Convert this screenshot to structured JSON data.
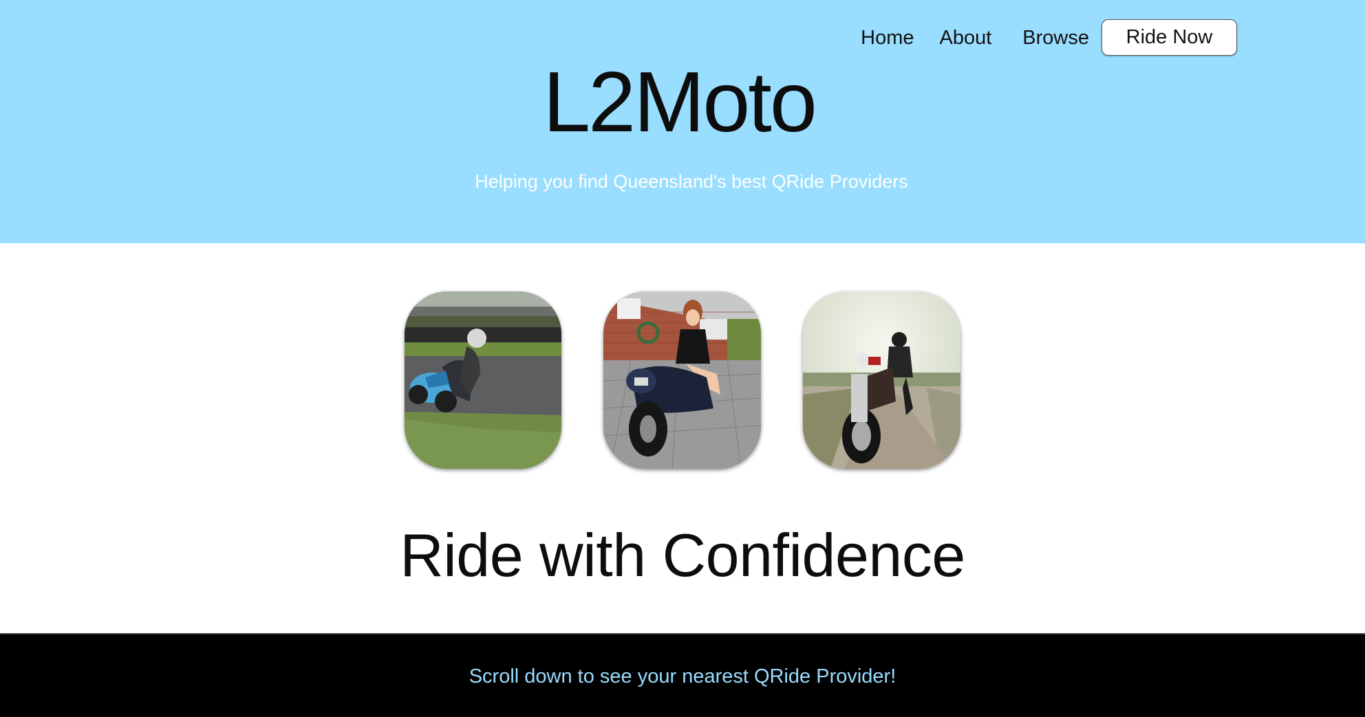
{
  "nav": {
    "home": "Home",
    "about": "About",
    "browse": "Browse",
    "ride_now": "Ride Now"
  },
  "hero": {
    "title": "L2Moto",
    "tagline": "Helping you find Queensland's best QRide Providers",
    "background": "#99ddff"
  },
  "gallery": {
    "images": [
      "motorcycle-racer-on-track-photo",
      "woman-on-motorcycle-photo",
      "cruiser-rider-on-road-photo"
    ]
  },
  "main": {
    "heading": "Ride with Confidence"
  },
  "footer": {
    "text": "Scroll down to see your nearest QRide Provider!",
    "text_color": "#99ddff",
    "background": "#000000"
  }
}
